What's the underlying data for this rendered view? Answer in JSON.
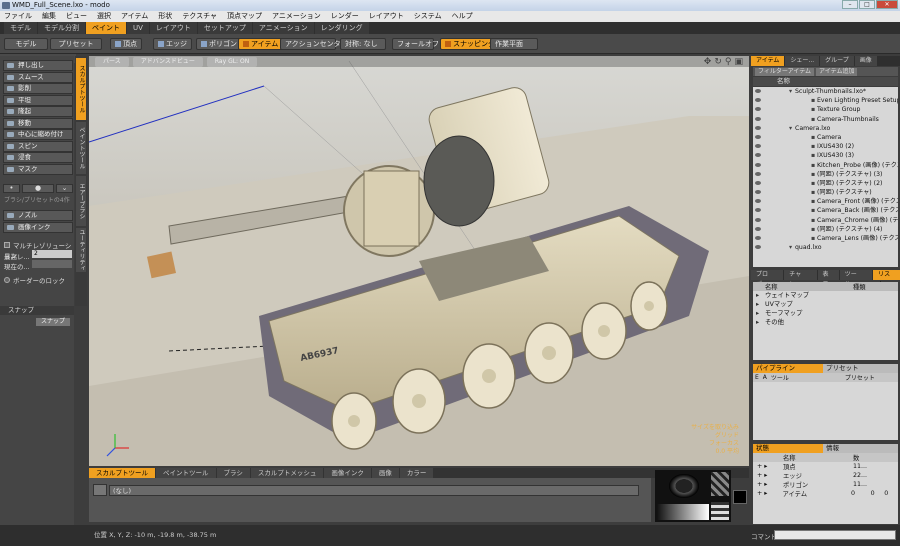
{
  "window": {
    "title": "WMD_Full_Scene.lxo - modo"
  },
  "menu": [
    "ファイル",
    "編集",
    "ビュー",
    "選択",
    "アイテム",
    "形状",
    "テクスチャ",
    "頂点マップ",
    "アニメーション",
    "レンダー",
    "レイアウト",
    "システム",
    "ヘルプ"
  ],
  "layout_tabs": [
    {
      "label": "モデル",
      "active": false
    },
    {
      "label": "モデル分割",
      "active": false
    },
    {
      "label": "ペイント",
      "active": true
    },
    {
      "label": "UV",
      "active": false
    },
    {
      "label": "レイアウト",
      "active": false
    },
    {
      "label": "セットアップ",
      "active": false
    },
    {
      "label": "アニメーション",
      "active": false
    },
    {
      "label": "レンダリング",
      "active": false
    }
  ],
  "toolbar": {
    "model": "モデル",
    "preset": "プリセット",
    "vertex": "頂点",
    "edge": "エッジ",
    "polygon": "ポリゴン",
    "item": "アイテム",
    "action_center": "アクションセンター",
    "symmetry": "対称: なし",
    "falloff": "フォールオフ",
    "snapping": "スナッピング",
    "work_plane": "作業平面"
  },
  "left_tools": [
    "押し出し",
    "スムース",
    "影削",
    "平坦",
    "隆起",
    "移動",
    "中心に縮め付け",
    "スピン",
    "浸食",
    "マスク"
  ],
  "left_tools2": [
    "ノズル",
    "画像インク"
  ],
  "left_labels": {
    "presets": "ブラシ/プリセットの4作",
    "multires": "マルチレゾリューション",
    "max_level_label": "最高レ...",
    "max_level_value": "2",
    "current_label": "現在の...",
    "border_lock": "ボーダーのロック",
    "snap_header": "スナップ",
    "snap_button": "スナップ"
  },
  "vertical_tabs": [
    "スカルプトツール",
    "ペイントツール",
    "エアーブラシ",
    "ユーティリティ"
  ],
  "viewport": {
    "head": [
      "パース",
      "アドバンスドビュー",
      "Ray GL: ON"
    ],
    "hud": [
      "サイズを取り込み",
      "グリッド",
      "フォーカス",
      "0.0 平均"
    ],
    "decal": "AB6937"
  },
  "bottom_tabs": [
    {
      "label": "スカルプトツール",
      "active": true
    },
    {
      "label": "ペイントツール",
      "active": false
    },
    {
      "label": "ブラシ",
      "active": false
    },
    {
      "label": "スカルプトメッシュ",
      "active": false
    },
    {
      "label": "画像インク",
      "active": false
    },
    {
      "label": "画像",
      "active": false
    },
    {
      "label": "カラー",
      "active": false
    }
  ],
  "brush_value": "(なし)",
  "status": "位置 X, Y, Z:  -10 m, -19.8 m, -38.75 m",
  "command_label": "コマンド",
  "items_panel": {
    "tabs": [
      {
        "label": "アイテム",
        "active": true
      },
      {
        "label": "シェー...",
        "active": false
      },
      {
        "label": "グループ",
        "active": false
      },
      {
        "label": "画像",
        "active": false
      }
    ],
    "filter": "フィルターアイテム",
    "add": "アイテム追加",
    "name_header": "名称",
    "tree": [
      {
        "label": "Sculpt-Thumbnails.lxo*",
        "depth": 0
      },
      {
        "label": "Even Lighting Preset Setup",
        "depth": 1
      },
      {
        "label": "Texture Group",
        "depth": 1
      },
      {
        "label": "Camera-Thumbnails",
        "depth": 1
      },
      {
        "label": "Camera.lxo",
        "depth": 0
      },
      {
        "label": "Camera",
        "depth": 1
      },
      {
        "label": "IXUS430 (2)",
        "depth": 1
      },
      {
        "label": "IXUS430 (3)",
        "depth": 1
      },
      {
        "label": "Kitchen_Probe (画像) (テクス",
        "depth": 1
      },
      {
        "label": "(同距) (テクスチャ) (3)",
        "depth": 1
      },
      {
        "label": "(同距) (テクスチャ) (2)",
        "depth": 1
      },
      {
        "label": "(同距) (テクスチャ)",
        "depth": 1
      },
      {
        "label": "Camera_Front (画像) (テクス",
        "depth": 1
      },
      {
        "label": "Camera_Back (画像) (テクス",
        "depth": 1
      },
      {
        "label": "Camera_Chrome (画像) (テク",
        "depth": 1
      },
      {
        "label": "(同距) (テクスチャ) (4)",
        "depth": 1
      },
      {
        "label": "Camera_Lens (画像) (テクス",
        "depth": 1
      },
      {
        "label": "quad.lxo",
        "depth": 0
      }
    ]
  },
  "list_panel": {
    "tabs": [
      {
        "label": "プロパ...",
        "active": false
      },
      {
        "label": "チャン...",
        "active": false
      },
      {
        "label": "表示",
        "active": false
      },
      {
        "label": "ツール...",
        "active": false
      },
      {
        "label": "リスト",
        "active": true
      }
    ],
    "col_name": "名称",
    "col_type": "種類",
    "rows": [
      "ウェイトマップ",
      "UVマップ",
      "モーフマップ",
      "その他"
    ]
  },
  "pipeline": {
    "label": "パイプライン",
    "preset": "プリセット",
    "cols": [
      "E",
      "A",
      "ツール",
      "プリセット"
    ]
  },
  "stats": {
    "tab": "状態",
    "info": "情報",
    "col_name": "名称",
    "col_count": "数",
    "rows": [
      {
        "name": "頂点",
        "count": "11..."
      },
      {
        "name": "エッジ",
        "count": "22..."
      },
      {
        "name": "ポリゴン",
        "count": "11..."
      },
      {
        "name": "アイテム",
        "count": "0"
      }
    ],
    "extra": [
      "0",
      "0"
    ]
  }
}
